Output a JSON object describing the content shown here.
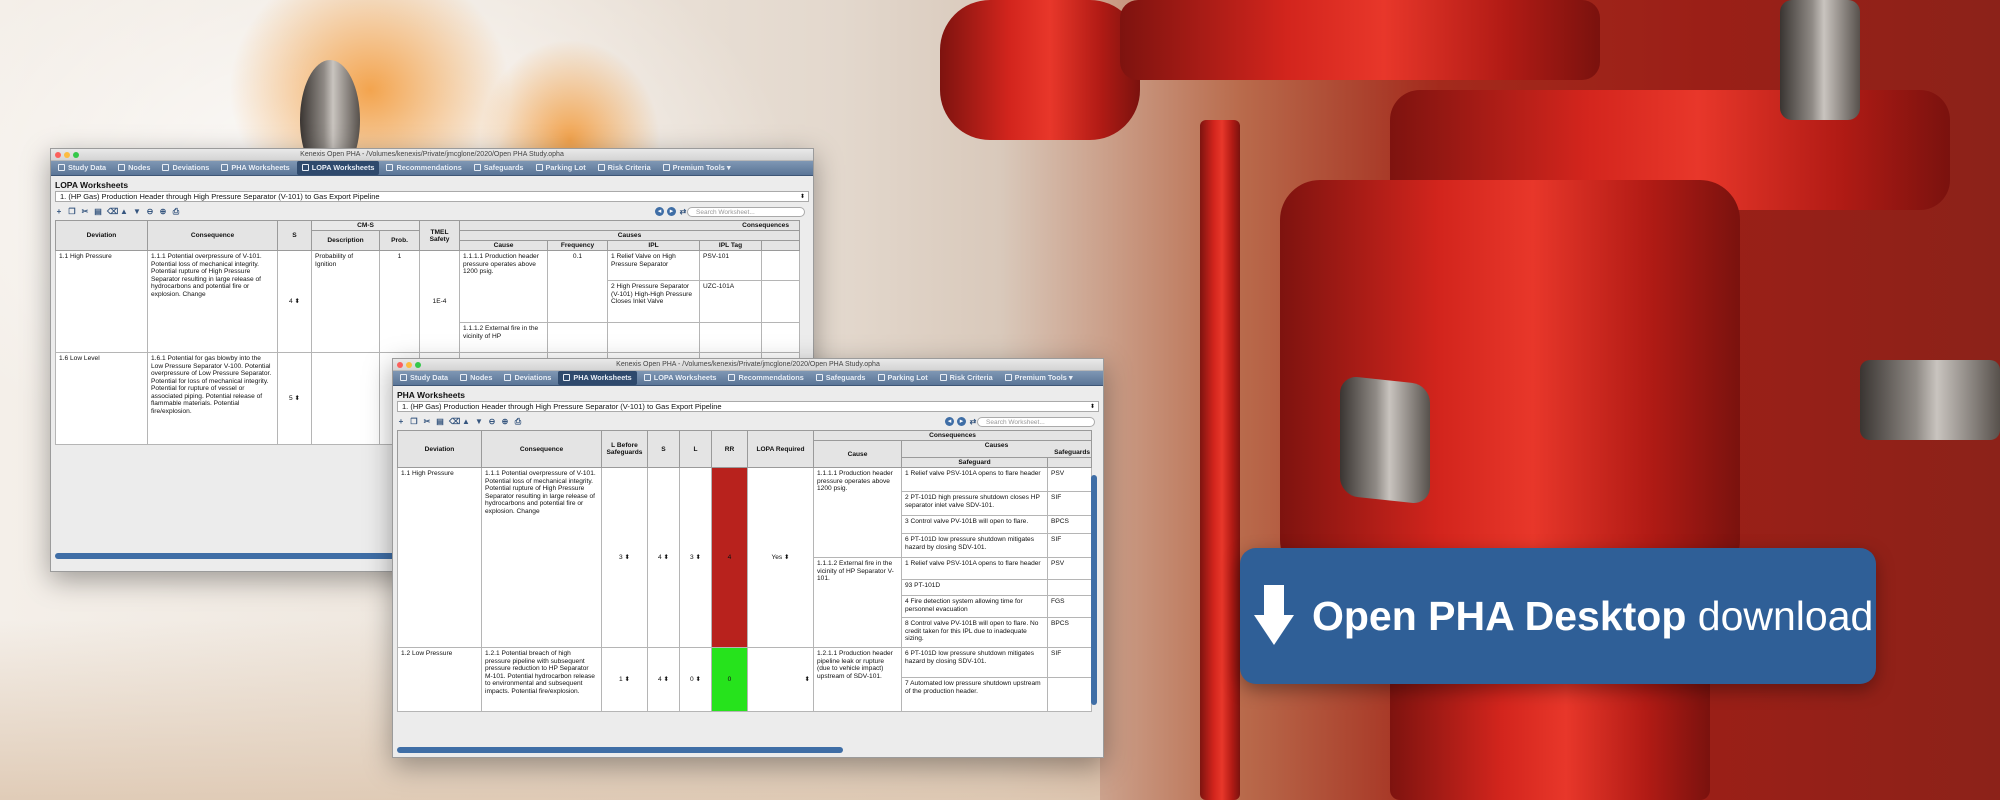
{
  "lopa_window": {
    "title": "Kenexis Open PHA - /Volumes/kenexis/Private/jmcglone/2020/Open PHA Study.opha",
    "tabs": [
      {
        "label": "Study Data",
        "active": false
      },
      {
        "label": "Nodes",
        "active": false
      },
      {
        "label": "Deviations",
        "active": false
      },
      {
        "label": "PHA Worksheets",
        "active": false
      },
      {
        "label": "LOPA Worksheets",
        "active": true
      },
      {
        "label": "Recommendations",
        "active": false
      },
      {
        "label": "Safeguards",
        "active": false
      },
      {
        "label": "Parking Lot",
        "active": false
      },
      {
        "label": "Risk Criteria",
        "active": false
      },
      {
        "label": "Premium Tools",
        "active": false
      }
    ],
    "sheet_title": "LOPA Worksheets",
    "node_select": "1. (HP Gas) Production Header through High Pressure Separator (V-101) to Gas Export Pipeline",
    "search_placeholder": "Search Worksheet...",
    "headers": {
      "deviation": "Deviation",
      "consequence": "Consequence",
      "s": "S",
      "cms": "CM-S",
      "description": "Description",
      "prob": "Prob.",
      "tmel": "TMEL Safety",
      "consequences": "Consequences",
      "causes": "Causes",
      "cause": "Cause",
      "frequency": "Frequency",
      "ipls": "IPLs",
      "ipl": "IPL",
      "ipl_tag": "IPL Tag"
    },
    "rows": [
      {
        "deviation": "1.1 High Pressure",
        "consequence": "1.1.1 Potential overpressure of V-101.  Potential loss of mechanical integrity.  Potential rupture of High Pressure Separator resulting in large release of hydrocarbons and potential fire or explosion. Change",
        "s": "4",
        "description": "Probability of Ignition",
        "prob": "1",
        "tmel": "1E-4",
        "cause": "1.1.1.1 Production header pressure operates above 1200 psig.",
        "frequency": "0.1",
        "ipls": [
          {
            "ipl": "1 Relief Valve on High Pressure Separator",
            "tag": "PSV-101"
          },
          {
            "ipl": "2 High Pressure Separator (V-101) High-High Pressure Closes Inlet Valve",
            "tag": "UZC-101A"
          }
        ],
        "cause2": "1.1.1.2 External fire in the vicinity of HP"
      },
      {
        "deviation": "1.6 Low Level",
        "consequence": "1.6.1 Potential for gas blowby into the Low Pressure Separator V-100.  Potential overpressure of Low Pressure Separator.  Potential for loss of mechanical integrity.  Potential for rupture of vessel or associated piping.  Potential release of flammable materials.  Potential fire/explosion.",
        "s": "5"
      }
    ]
  },
  "pha_window": {
    "title": "Kenexis Open PHA - /Volumes/kenexis/Private/jmcglone/2020/Open PHA Study.opha",
    "tabs": [
      {
        "label": "Study Data",
        "active": false
      },
      {
        "label": "Nodes",
        "active": false
      },
      {
        "label": "Deviations",
        "active": false
      },
      {
        "label": "PHA Worksheets",
        "active": true
      },
      {
        "label": "LOPA Worksheets",
        "active": false
      },
      {
        "label": "Recommendations",
        "active": false
      },
      {
        "label": "Safeguards",
        "active": false
      },
      {
        "label": "Parking Lot",
        "active": false
      },
      {
        "label": "Risk Criteria",
        "active": false
      },
      {
        "label": "Premium Tools",
        "active": false
      }
    ],
    "sheet_title": "PHA Worksheets",
    "node_select": "1. (HP Gas) Production Header through High Pressure Separator (V-101) to Gas Export Pipeline",
    "search_placeholder": "Search Worksheet...",
    "headers": {
      "deviation": "Deviation",
      "consequence": "Consequence",
      "l_before": "L Before Safeguards",
      "s": "S",
      "l": "L",
      "rr": "RR",
      "lopa": "LOPA Required",
      "consequences": "Consequences",
      "causes": "Causes",
      "cause": "Cause",
      "safeguards": "Safeguards",
      "safeguard": "Safeguard"
    },
    "rows": [
      {
        "deviation": "1.1 High Pressure",
        "consequence": "1.1.1 Potential overpressure of V-101.  Potential loss of mechanical integrity.  Potential rupture of High Pressure Separator resulting in large release of hydrocarbons and potential fire or explosion. Change",
        "l_before": "3",
        "s": "4",
        "l": "3",
        "rr": "4",
        "lopa": "Yes",
        "rr_color": "#b8221d",
        "causes": [
          {
            "cause": "1.1.1.1 Production header pressure operates above 1200 psig.",
            "safeguards": [
              {
                "text": "1 Relief valve PSV-101A opens to flare header",
                "type": "PSV"
              },
              {
                "text": "2 PT-101D high pressure shutdown closes HP separator inlet valve SDV-101.",
                "type": "SIF"
              },
              {
                "text": "3 Control valve PV-101B will open to flare.",
                "type": "BPCS"
              },
              {
                "text": "6 PT-101D low pressure shutdown mitigates hazard by closing SDV-101.",
                "type": "SIF"
              }
            ]
          },
          {
            "cause": "1.1.1.2 External fire in the vicinity of HP Separator V-101.",
            "safeguards": [
              {
                "text": "1 Relief valve PSV-101A opens to flare header",
                "type": "PSV"
              },
              {
                "text": "93 PT-101D",
                "type": ""
              },
              {
                "text": "4 Fire detection system allowing time for personnel evacuation",
                "type": "FGS"
              },
              {
                "text": "8 Control valve PV-101B will open to flare.  No credit taken for this IPL due to inadequate sizing.",
                "type": "BPCS"
              }
            ]
          }
        ]
      },
      {
        "deviation": "1.2 Low Pressure",
        "consequence": "1.2.1 Potential breach of high pressure pipeline with subsequent pressure reduction to HP Separator M-101.  Potential hydrocarbon release to environmental and subsequent impacts. Potential fire/explosion.",
        "l_before": "1",
        "s": "4",
        "l": "0",
        "rr": "0",
        "lopa": "",
        "rr_color": "#26e31c",
        "causes": [
          {
            "cause": "1.2.1.1 Production header pipeline leak or rupture (due to vehicle impact) upstream of SDV-101.",
            "safeguards": [
              {
                "text": "6 PT-101D low pressure shutdown mitigates hazard by closing SDV-101.",
                "type": "SIF"
              },
              {
                "text": "7 Automated low pressure shutdown upstream of the production header.",
                "type": ""
              }
            ]
          }
        ]
      }
    ]
  },
  "cta": {
    "bold": "Open PHA Desktop",
    "rest": " download",
    "icon": "download-arrow-icon",
    "color": "#2f5f97"
  },
  "colors": {
    "tab_bar": "#5a7597",
    "tab_active": "#2f4a6d",
    "rr_high": "#b8221d",
    "rr_low": "#26e31c"
  }
}
